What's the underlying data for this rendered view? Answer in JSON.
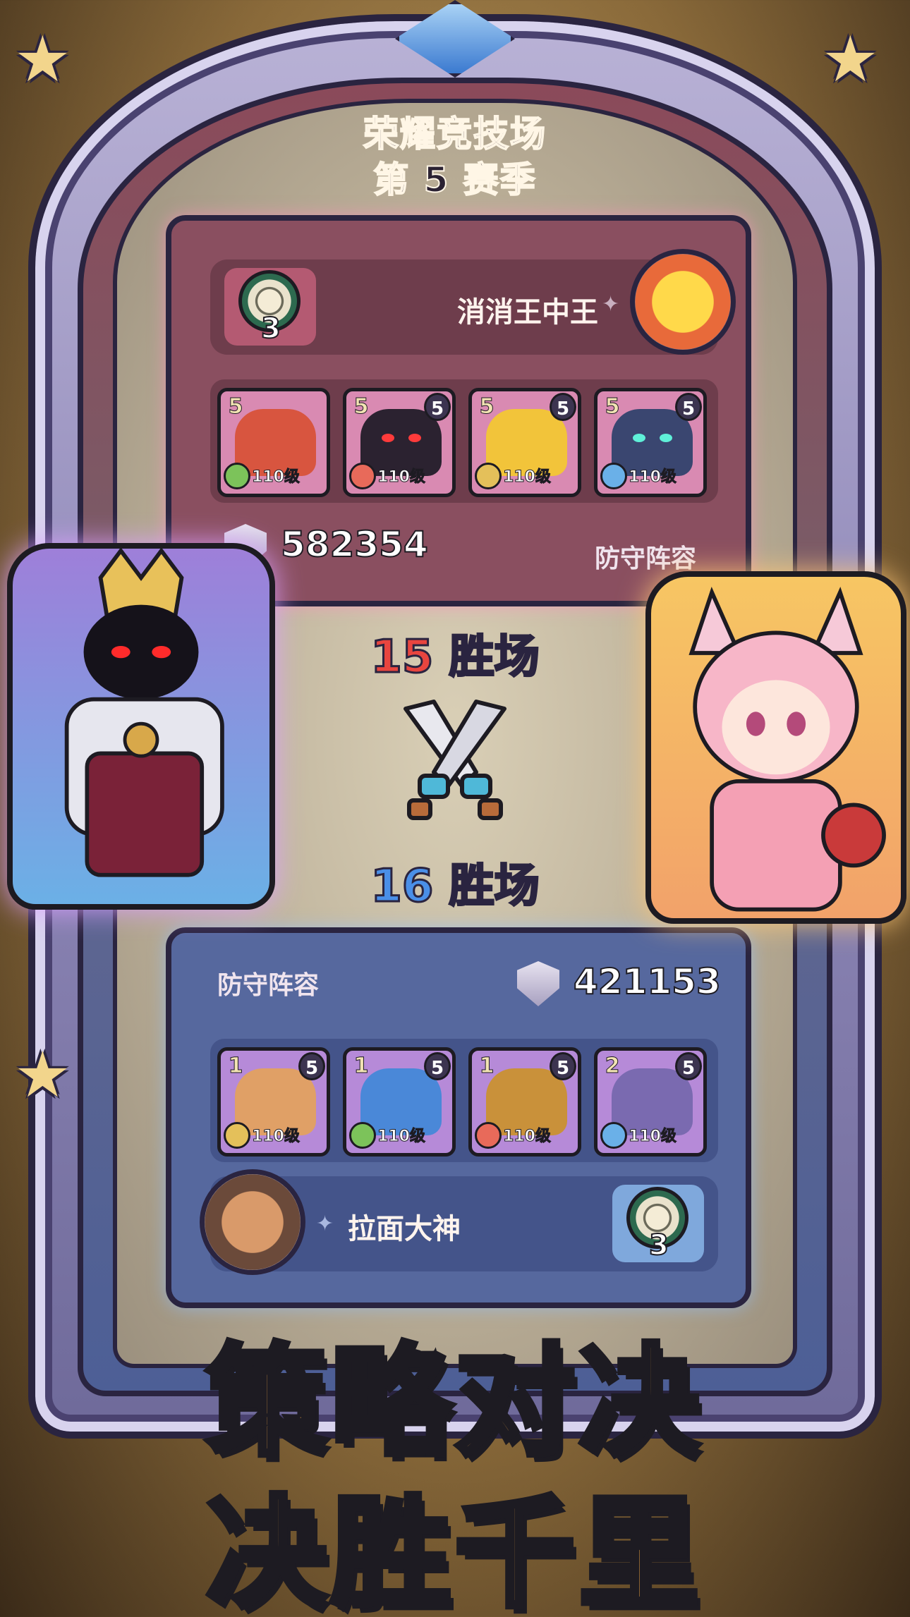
{
  "header": {
    "title": "荣耀竞技场",
    "season": "第 5 赛季"
  },
  "opponent": {
    "name": "消消王中王",
    "medal_count": "3",
    "power": "582354",
    "lineup_label": "防守阵容",
    "heroes": [
      {
        "star": "5",
        "rank": "",
        "level": "110级",
        "element": "leaf",
        "color": "#d8553f"
      },
      {
        "star": "5",
        "rank": "5",
        "level": "110级",
        "element": "fire",
        "color": "#2b2230"
      },
      {
        "star": "5",
        "rank": "5",
        "level": "110级",
        "element": "earth",
        "color": "#f2c43a"
      },
      {
        "star": "5",
        "rank": "5",
        "level": "110级",
        "element": "water",
        "color": "#3a4670"
      }
    ]
  },
  "player": {
    "name": "拉面大神",
    "medal_count": "3",
    "power": "421153",
    "lineup_label": "防守阵容",
    "heroes": [
      {
        "star": "1",
        "rank": "5",
        "level": "110级",
        "element": "earth",
        "color": "#e0a066"
      },
      {
        "star": "1",
        "rank": "5",
        "level": "110级",
        "element": "leaf",
        "color": "#4a88d8"
      },
      {
        "star": "1",
        "rank": "5",
        "level": "110级",
        "element": "fire",
        "color": "#c9913a"
      },
      {
        "star": "2",
        "rank": "5",
        "level": "110级",
        "element": "water",
        "color": "#7a6ab0"
      }
    ]
  },
  "matchup": {
    "opponent_wins": "15 胜场",
    "player_wins": "16 胜场"
  },
  "slogan": {
    "line1": "策略对决",
    "line2": "决胜千里"
  },
  "colors": {
    "red_team": "#8a4f60",
    "blue_team": "#56689e",
    "slogan": "#ffb347"
  }
}
